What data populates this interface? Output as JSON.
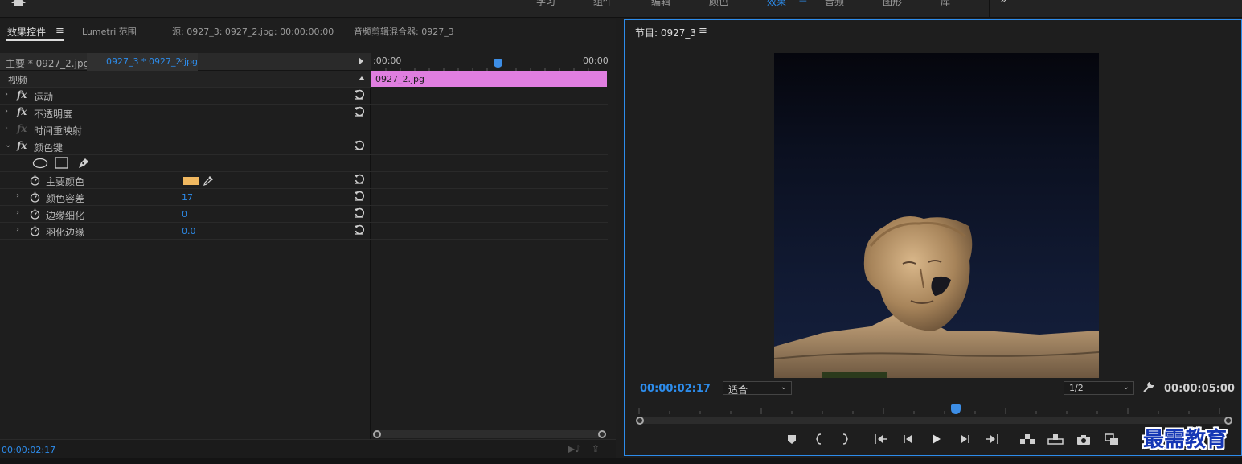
{
  "workspace": {
    "tabs": [
      {
        "label": "学习"
      },
      {
        "label": "组件"
      },
      {
        "label": "编辑"
      },
      {
        "label": "颜色"
      },
      {
        "label": "效果",
        "active": true
      },
      {
        "label": "音频"
      },
      {
        "label": "图形"
      },
      {
        "label": "库"
      }
    ],
    "more": "»"
  },
  "left_panel": {
    "tabs": [
      "效果控件",
      "Lumetri 范围",
      "源: 0927_3: 0927_2.jpg: 00:00:00:00",
      "音频剪辑混合器: 0927_3"
    ],
    "menu": "≡",
    "seq_master": "主要 * 0927_2.jpg",
    "seq_current": "0927_3 * 0927_2.jpg",
    "section": "视频",
    "effects": [
      {
        "label": "运动"
      },
      {
        "label": "不透明度"
      },
      {
        "label": "时间重映射"
      },
      {
        "label": "颜色键"
      }
    ],
    "properties": [
      {
        "label": "主要颜色",
        "value": ""
      },
      {
        "label": "颜色容差",
        "value": "17"
      },
      {
        "label": "边缘细化",
        "value": "0"
      },
      {
        "label": "羽化边缘",
        "value": "0.0"
      }
    ],
    "timecode": "00:00:02:17",
    "key_color": "#f0b860"
  },
  "timeline": {
    "start": ":00:00",
    "end": "00:00",
    "clip": "0927_2.jpg",
    "clip_color": "#e07ee0"
  },
  "program": {
    "title": "节目: 0927_3",
    "menu": "≡",
    "timecode_current": "00:00:02:17",
    "fit": "适合",
    "resolution": "1/2",
    "timecode_duration": "00:00:05:00",
    "accent": "#2d8ceb"
  },
  "watermark": "最需教育"
}
